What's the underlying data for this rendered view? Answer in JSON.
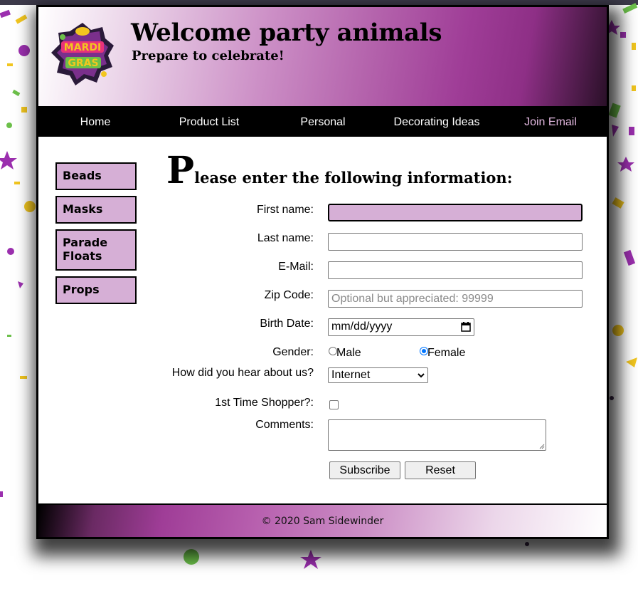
{
  "header": {
    "logo_icon": "mardi-gras-logo-icon",
    "title": "Welcome party animals",
    "subtitle": "Prepare to celebrate!"
  },
  "nav": {
    "items": [
      {
        "label": "Home"
      },
      {
        "label": "Product List"
      },
      {
        "label": "Personal"
      },
      {
        "label": "Decorating Ideas"
      },
      {
        "label": "Join Email"
      }
    ],
    "active_color": "#e2b7df"
  },
  "sidebar": {
    "items": [
      {
        "label": "Beads"
      },
      {
        "label": "Masks"
      },
      {
        "label": "Parade Floats"
      },
      {
        "label": "Props"
      }
    ]
  },
  "form": {
    "heading_first_letter": "P",
    "heading_rest": "lease enter the following information:",
    "first_name": {
      "label": "First name:",
      "value": ""
    },
    "last_name": {
      "label": "Last name:",
      "value": ""
    },
    "email": {
      "label": "E-Mail:",
      "value": ""
    },
    "zip": {
      "label": "Zip Code:",
      "placeholder": "Optional but appreciated: 99999"
    },
    "birth_date": {
      "label": "Birth Date:",
      "placeholder": "mm/dd/yyyy"
    },
    "gender": {
      "label": "Gender:",
      "options": [
        "Male",
        "Female"
      ],
      "selected": "Female"
    },
    "hear_about": {
      "label": "How did you hear about us?",
      "selected": "Internet"
    },
    "first_time": {
      "label": "1st Time Shopper?:",
      "checked": false
    },
    "comments": {
      "label": "Comments:",
      "value": ""
    },
    "subscribe_label": "Subscribe",
    "reset_label": "Reset"
  },
  "footer": {
    "text": "© 2020 Sam Sidewinder"
  },
  "colors": {
    "purple": "#9f3d97",
    "lavender": "#d6afd6",
    "nav_bg": "#000000"
  }
}
